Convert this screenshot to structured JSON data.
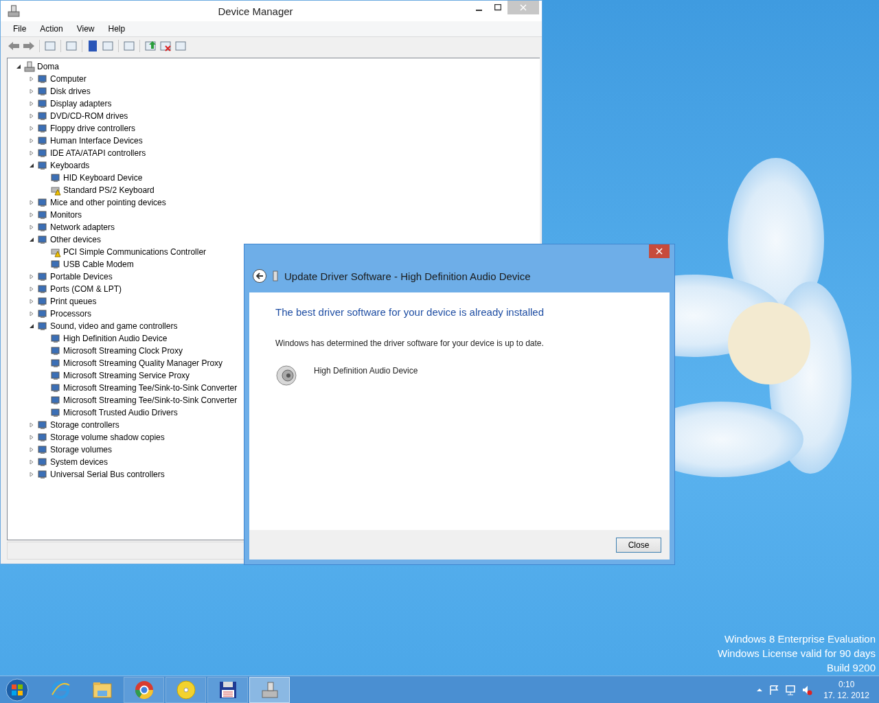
{
  "device_manager": {
    "title": "Device Manager",
    "menu": [
      "File",
      "Action",
      "View",
      "Help"
    ],
    "tree": {
      "label": "Doma",
      "expanded": true,
      "children": [
        {
          "label": "Computer",
          "expanded": false
        },
        {
          "label": "Disk drives",
          "expanded": false
        },
        {
          "label": "Display adapters",
          "expanded": false
        },
        {
          "label": "DVD/CD-ROM drives",
          "expanded": false
        },
        {
          "label": "Floppy drive controllers",
          "expanded": false
        },
        {
          "label": "Human Interface Devices",
          "expanded": false
        },
        {
          "label": "IDE ATA/ATAPI controllers",
          "expanded": false
        },
        {
          "label": "Keyboards",
          "expanded": true,
          "children": [
            {
              "label": "HID Keyboard Device",
              "warning": false
            },
            {
              "label": "Standard PS/2 Keyboard",
              "warning": true
            }
          ]
        },
        {
          "label": "Mice and other pointing devices",
          "expanded": false
        },
        {
          "label": "Monitors",
          "expanded": false
        },
        {
          "label": "Network adapters",
          "expanded": false
        },
        {
          "label": "Other devices",
          "expanded": true,
          "children": [
            {
              "label": "PCI Simple Communications Controller",
              "warning": true
            },
            {
              "label": "USB Cable Modem",
              "warning": false
            }
          ]
        },
        {
          "label": "Portable Devices",
          "expanded": false
        },
        {
          "label": "Ports (COM & LPT)",
          "expanded": false
        },
        {
          "label": "Print queues",
          "expanded": false
        },
        {
          "label": "Processors",
          "expanded": false
        },
        {
          "label": "Sound, video and game controllers",
          "expanded": true,
          "children": [
            {
              "label": "High Definition Audio Device",
              "warning": false
            },
            {
              "label": "Microsoft Streaming Clock Proxy",
              "warning": false
            },
            {
              "label": "Microsoft Streaming Quality Manager Proxy",
              "warning": false
            },
            {
              "label": "Microsoft Streaming Service Proxy",
              "warning": false
            },
            {
              "label": "Microsoft Streaming Tee/Sink-to-Sink Converter",
              "warning": false
            },
            {
              "label": "Microsoft Streaming Tee/Sink-to-Sink Converter",
              "warning": false
            },
            {
              "label": "Microsoft Trusted Audio Drivers",
              "warning": false
            }
          ]
        },
        {
          "label": "Storage controllers",
          "expanded": false
        },
        {
          "label": "Storage volume shadow copies",
          "expanded": false
        },
        {
          "label": "Storage volumes",
          "expanded": false
        },
        {
          "label": "System devices",
          "expanded": false
        },
        {
          "label": "Universal Serial Bus controllers",
          "expanded": false
        }
      ]
    }
  },
  "dialog": {
    "title": "Update Driver Software - High Definition Audio Device",
    "heading": "The best driver software for your device is already installed",
    "message": "Windows has determined the driver software for your device is up to date.",
    "device": "High Definition Audio Device",
    "button": "Close"
  },
  "watermark_text": [
    "Windows 8 Enterprise Evaluation",
    "Windows License valid for 90 days",
    "Build 9200"
  ],
  "taskbar": {
    "items": [
      {
        "kind": "ie",
        "running": false,
        "selected": false
      },
      {
        "kind": "explorer",
        "running": false,
        "selected": false
      },
      {
        "kind": "chrome",
        "running": true,
        "selected": false
      },
      {
        "kind": "disc",
        "running": true,
        "selected": false
      },
      {
        "kind": "floppy",
        "running": true,
        "selected": false
      },
      {
        "kind": "devmgr",
        "running": true,
        "selected": true
      }
    ],
    "time": "0:10",
    "date": "17. 12. 2012"
  }
}
